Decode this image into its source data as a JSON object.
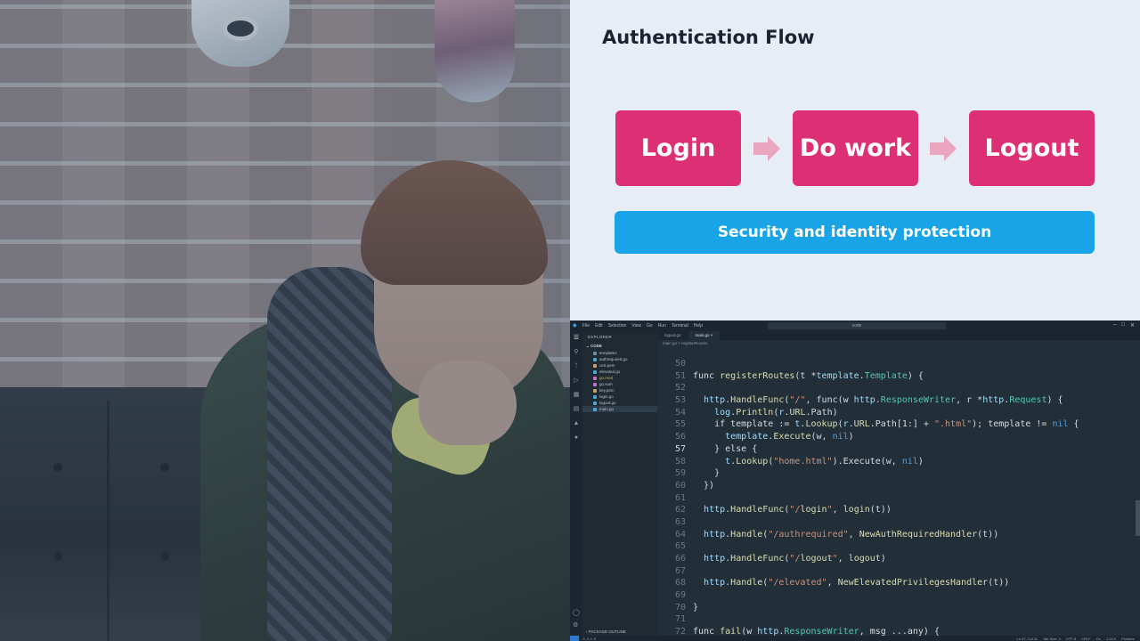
{
  "slide": {
    "title": "Authentication Flow",
    "steps": [
      "Login",
      "Do work",
      "Logout"
    ],
    "bar_text": "Security and identity protection",
    "colors": {
      "step": "#dd2f74",
      "bar": "#1aa4e8",
      "arrow": "#eaa6be",
      "background": "#e6edf4"
    }
  },
  "vscode": {
    "menu": [
      "File",
      "Edit",
      "Selection",
      "View",
      "Go",
      "Run",
      "Terminal",
      "Help"
    ],
    "search_placeholder": "code",
    "sidebar": {
      "title": "EXPLORER",
      "root": "CODE",
      "items": [
        {
          "name": "templates",
          "icon": "folder-icon"
        },
        {
          "name": "authrequired.go",
          "icon": "go-file-icon"
        },
        {
          "name": "cert.pem",
          "icon": "cert-file-icon"
        },
        {
          "name": "elevated.go",
          "icon": "go-file-icon"
        },
        {
          "name": "go.mod",
          "icon": "go-mod-icon",
          "status": "warning"
        },
        {
          "name": "go.sum",
          "icon": "go-sum-icon"
        },
        {
          "name": "key.pem",
          "icon": "key-file-icon"
        },
        {
          "name": "login.go",
          "icon": "go-file-icon"
        },
        {
          "name": "logout.go",
          "icon": "go-file-icon"
        },
        {
          "name": "main.go",
          "icon": "go-file-icon",
          "selected": true
        }
      ],
      "outline": "PACKAGE OUTLINE"
    },
    "tabs": [
      {
        "label": "logout.go",
        "active": false
      },
      {
        "label": "main.go",
        "active": true
      }
    ],
    "breadcrumb": "main.go > registerRoutes",
    "current_line": 57,
    "lines": [
      {
        "n": 50,
        "code": ""
      },
      {
        "n": 51,
        "code": "func registerRoutes(t *template.Template) {"
      },
      {
        "n": 52,
        "code": ""
      },
      {
        "n": 53,
        "code": "  http.HandleFunc(\"/\", func(w http.ResponseWriter, r *http.Request) {"
      },
      {
        "n": 54,
        "code": "    log.Println(r.URL.Path)"
      },
      {
        "n": 55,
        "code": "    if template := t.Lookup(r.URL.Path[1:] + \".html\"); template != nil {"
      },
      {
        "n": 56,
        "code": "      template.Execute(w, nil)"
      },
      {
        "n": 57,
        "code": "    } else {"
      },
      {
        "n": 58,
        "code": "      t.Lookup(\"home.html\").Execute(w, nil)"
      },
      {
        "n": 59,
        "code": "    }"
      },
      {
        "n": 60,
        "code": "  })"
      },
      {
        "n": 61,
        "code": ""
      },
      {
        "n": 62,
        "code": "  http.HandleFunc(\"/login\", login(t))"
      },
      {
        "n": 63,
        "code": ""
      },
      {
        "n": 64,
        "code": "  http.Handle(\"/authrequired\", NewAuthRequiredHandler(t))"
      },
      {
        "n": 65,
        "code": ""
      },
      {
        "n": 66,
        "code": "  http.HandleFunc(\"/logout\", logout)"
      },
      {
        "n": 67,
        "code": ""
      },
      {
        "n": 68,
        "code": "  http.Handle(\"/elevated\", NewElevatedPrivilegesHandler(t))"
      },
      {
        "n": 69,
        "code": ""
      },
      {
        "n": 70,
        "code": "}"
      },
      {
        "n": 71,
        "code": ""
      },
      {
        "n": 72,
        "code": "func fail(w http.ResponseWriter, msg ...any) {"
      }
    ],
    "status": {
      "position": "Ln 57, Col 11",
      "tab_size": "Tab Size: 4",
      "encoding": "UTF-8",
      "eol": "CRLF",
      "language": "Go",
      "go_version": "1.24.0",
      "problems": "Problem"
    }
  }
}
